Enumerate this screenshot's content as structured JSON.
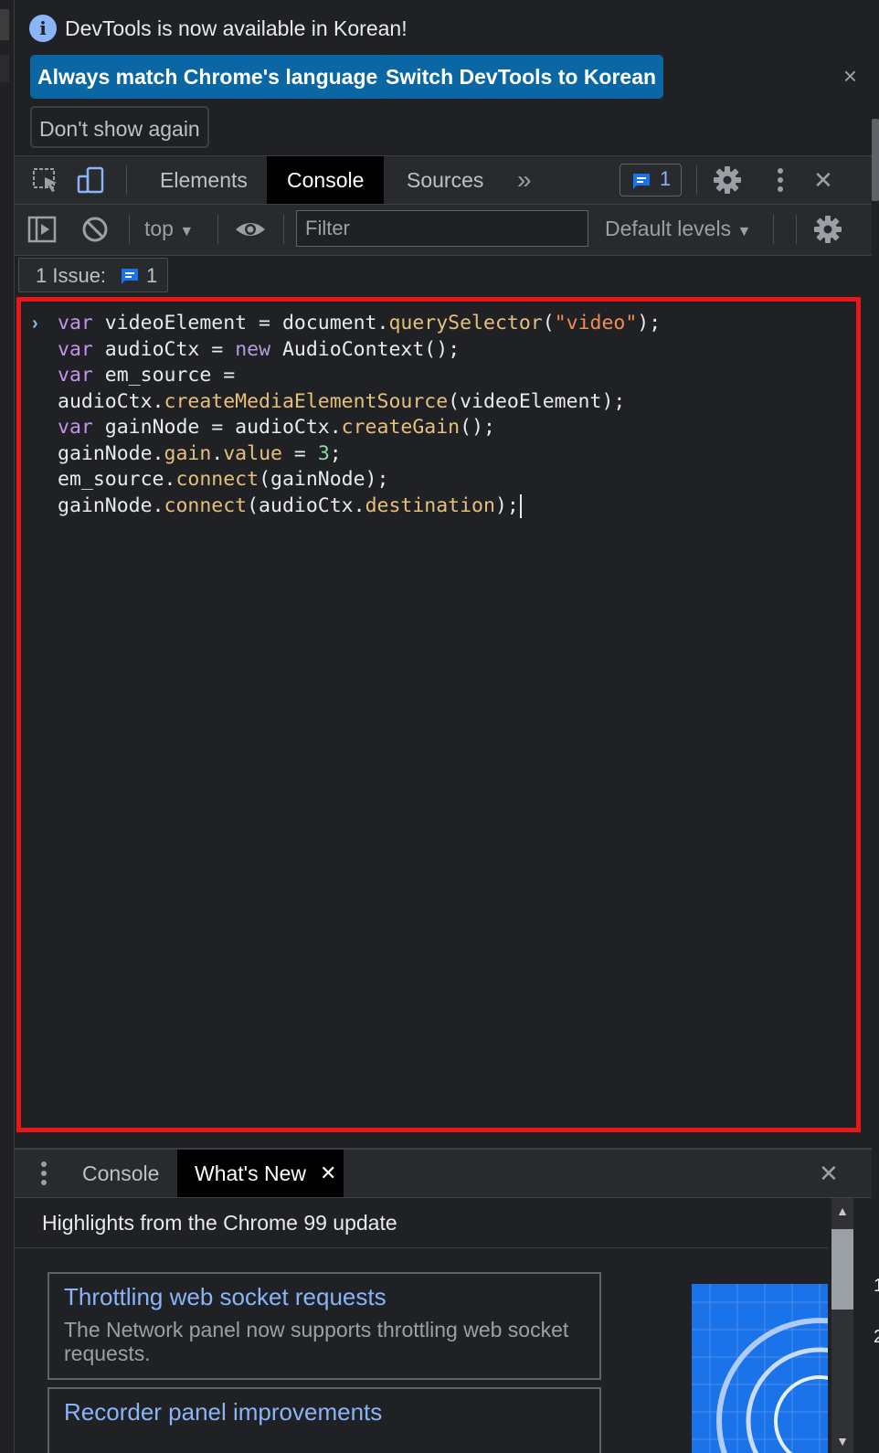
{
  "infobar": {
    "message": "DevTools is now available in Korean!",
    "buttons": {
      "match_language": "Always match Chrome's language",
      "switch_korean": "Switch DevTools to Korean",
      "dont_show": "Don't show again"
    },
    "close_glyph": "×"
  },
  "toolbar": {
    "tabs": [
      "Elements",
      "Console",
      "Sources"
    ],
    "active_tab": "Console",
    "more_tabs_glyph": "»",
    "issues_count": "1",
    "close_glyph": "✕"
  },
  "console_toolbar": {
    "context": "top",
    "filter_placeholder": "Filter",
    "levels": "Default levels"
  },
  "issues_bar": {
    "label": "1 Issue:",
    "count": "1"
  },
  "editor": {
    "prompt_glyph": "›",
    "lines": [
      "var videoElement = document.querySelector(\"video\");",
      "var audioCtx = new AudioContext();",
      "var em_source =",
      "audioCtx.createMediaElementSource(videoElement);",
      "var gainNode = audioCtx.createGain();",
      "gainNode.gain.value = 3;",
      "em_source.connect(gainNode);",
      "gainNode.connect(audioCtx.destination);"
    ]
  },
  "drawer": {
    "tabs": [
      "Console",
      "What's New"
    ],
    "active_tab": "What's New",
    "tab_close_glyph": "✕",
    "close_glyph": "✕",
    "header": "Highlights from the Chrome 99 update",
    "cards": [
      {
        "title": "Throttling web socket requests",
        "description": "The Network panel now supports throttling web socket requests."
      },
      {
        "title": "Recorder panel improvements",
        "description": ""
      }
    ],
    "side_numbers": [
      "1",
      "2"
    ]
  },
  "colors": {
    "background": "#202124",
    "toolbar": "#292a2d",
    "accent_blue": "#8ab4f8",
    "button_blue": "#0b67a4",
    "highlight_red": "#e8171a",
    "keyword": "#c792ea",
    "function": "#e5c07b",
    "string": "#f28b54",
    "number": "#7ee2a8"
  }
}
